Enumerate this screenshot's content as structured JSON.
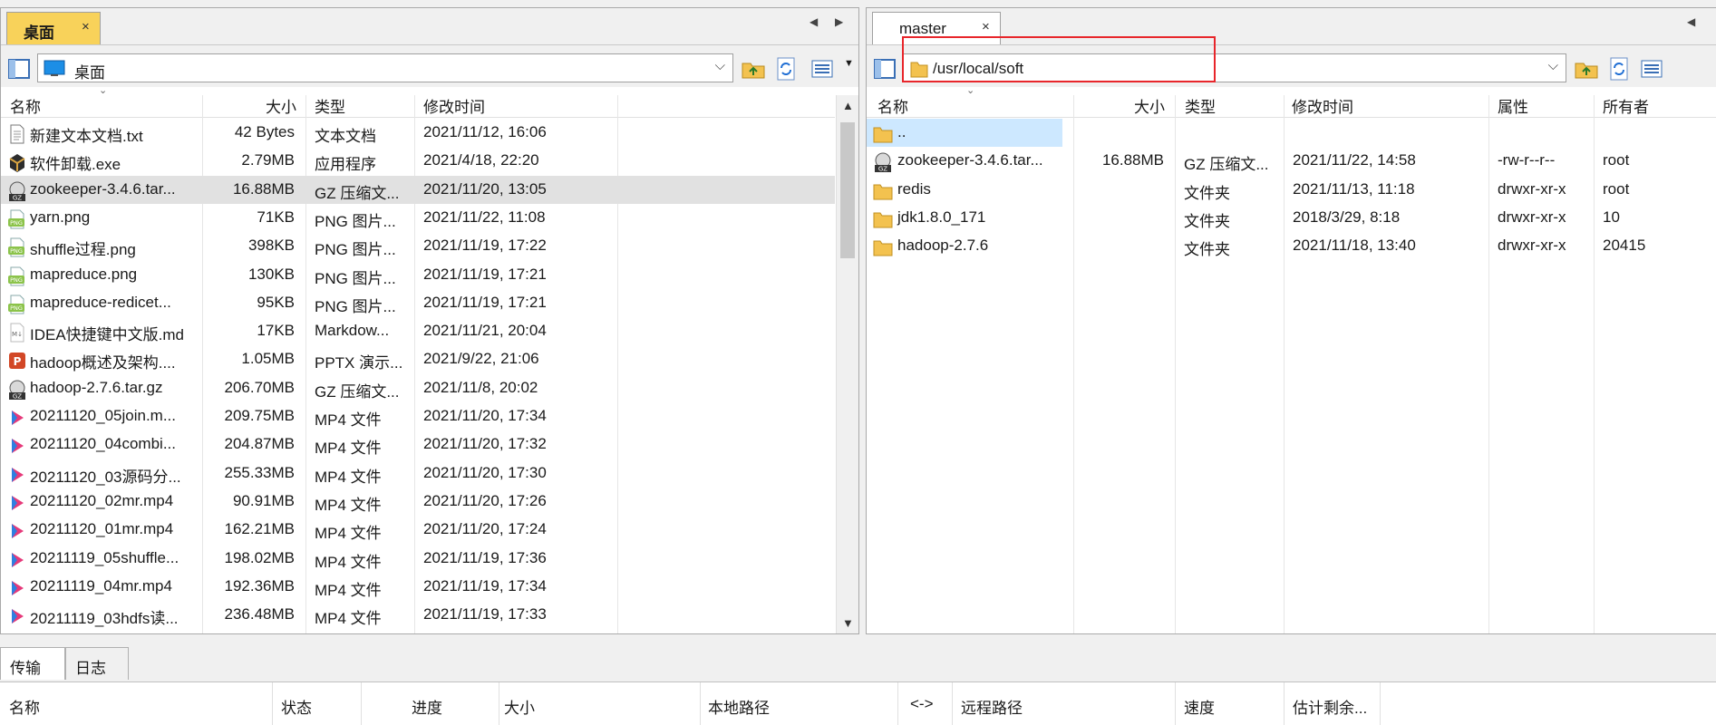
{
  "left": {
    "tab_label": "桌面",
    "tab_close": "×",
    "path": "桌面",
    "columns": [
      "名称",
      "大小",
      "类型",
      "修改时间"
    ],
    "files": [
      {
        "name": "新建文本文档.txt",
        "size": "42 Bytes",
        "type": "文本文档",
        "modified": "2021/11/12, 16:06",
        "icon": "text-file-icon"
      },
      {
        "name": "软件卸载.exe",
        "size": "2.79MB",
        "type": "应用程序",
        "modified": "2021/4/18, 22:20",
        "icon": "exe-icon"
      },
      {
        "name": "zookeeper-3.4.6.tar...",
        "size": "16.88MB",
        "type": "GZ 压缩文...",
        "modified": "2021/11/20, 13:05",
        "icon": "gz-icon"
      },
      {
        "name": "yarn.png",
        "size": "71KB",
        "type": "PNG 图片...",
        "modified": "2021/11/22, 11:08",
        "icon": "png-icon"
      },
      {
        "name": "shuffle过程.png",
        "size": "398KB",
        "type": "PNG 图片...",
        "modified": "2021/11/19, 17:22",
        "icon": "png-icon"
      },
      {
        "name": "mapreduce.png",
        "size": "130KB",
        "type": "PNG 图片...",
        "modified": "2021/11/19, 17:21",
        "icon": "png-icon"
      },
      {
        "name": "mapreduce-redicet...",
        "size": "95KB",
        "type": "PNG 图片...",
        "modified": "2021/11/19, 17:21",
        "icon": "png-icon"
      },
      {
        "name": "IDEA快捷键中文版.md",
        "size": "17KB",
        "type": "Markdow...",
        "modified": "2021/11/21, 20:04",
        "icon": "md-icon"
      },
      {
        "name": "hadoop概述及架构....",
        "size": "1.05MB",
        "type": "PPTX 演示...",
        "modified": "2021/9/22, 21:06",
        "icon": "pptx-icon"
      },
      {
        "name": "hadoop-2.7.6.tar.gz",
        "size": "206.70MB",
        "type": "GZ 压缩文...",
        "modified": "2021/11/8, 20:02",
        "icon": "gz-icon"
      },
      {
        "name": "20211120_05join.m...",
        "size": "209.75MB",
        "type": "MP4 文件",
        "modified": "2021/11/20, 17:34",
        "icon": "mp4-icon"
      },
      {
        "name": "20211120_04combi...",
        "size": "204.87MB",
        "type": "MP4 文件",
        "modified": "2021/11/20, 17:32",
        "icon": "mp4-icon"
      },
      {
        "name": "20211120_03源码分...",
        "size": "255.33MB",
        "type": "MP4 文件",
        "modified": "2021/11/20, 17:30",
        "icon": "mp4-icon"
      },
      {
        "name": "20211120_02mr.mp4",
        "size": "90.91MB",
        "type": "MP4 文件",
        "modified": "2021/11/20, 17:26",
        "icon": "mp4-icon"
      },
      {
        "name": "20211120_01mr.mp4",
        "size": "162.21MB",
        "type": "MP4 文件",
        "modified": "2021/11/20, 17:24",
        "icon": "mp4-icon"
      },
      {
        "name": "20211119_05shuffle...",
        "size": "198.02MB",
        "type": "MP4 文件",
        "modified": "2021/11/19, 17:36",
        "icon": "mp4-icon"
      },
      {
        "name": "20211119_04mr.mp4",
        "size": "192.36MB",
        "type": "MP4 文件",
        "modified": "2021/11/19, 17:34",
        "icon": "mp4-icon"
      },
      {
        "name": "20211119_03hdfs读...",
        "size": "236.48MB",
        "type": "MP4 文件",
        "modified": "2021/11/19, 17:33",
        "icon": "mp4-icon"
      }
    ]
  },
  "right": {
    "tab_label": "master",
    "tab_close": "×",
    "path": "/usr/local/soft",
    "columns": [
      "名称",
      "大小",
      "类型",
      "修改时间",
      "属性",
      "所有者"
    ],
    "files": [
      {
        "name": "..",
        "size": "",
        "type": "",
        "modified": "",
        "attrs": "",
        "owner": "",
        "icon": "folder-up-icon"
      },
      {
        "name": "zookeeper-3.4.6.tar...",
        "size": "16.88MB",
        "type": "GZ 压缩文...",
        "modified": "2021/11/22, 14:58",
        "attrs": "-rw-r--r--",
        "owner": "root",
        "icon": "gz-icon"
      },
      {
        "name": "redis",
        "size": "",
        "type": "文件夹",
        "modified": "2021/11/13, 11:18",
        "attrs": "drwxr-xr-x",
        "owner": "root",
        "icon": "folder-icon"
      },
      {
        "name": "jdk1.8.0_171",
        "size": "",
        "type": "文件夹",
        "modified": "2018/3/29, 8:18",
        "attrs": "drwxr-xr-x",
        "owner": "10",
        "icon": "folder-icon"
      },
      {
        "name": "hadoop-2.7.6",
        "size": "",
        "type": "文件夹",
        "modified": "2021/11/18, 13:40",
        "attrs": "drwxr-xr-x",
        "owner": "20415",
        "icon": "folder-icon"
      }
    ]
  },
  "bottom": {
    "tabs": [
      "传输",
      "日志"
    ],
    "columns": [
      "名称",
      "状态",
      "进度",
      "大小",
      "本地路径",
      "<->",
      "远程路径",
      "速度",
      "估计剩余..."
    ]
  },
  "colors": {
    "active_tab": "#f8d25a",
    "highlight_box": "#e8262b",
    "folder": "#f3c24f",
    "selection": "#cde8ff"
  }
}
